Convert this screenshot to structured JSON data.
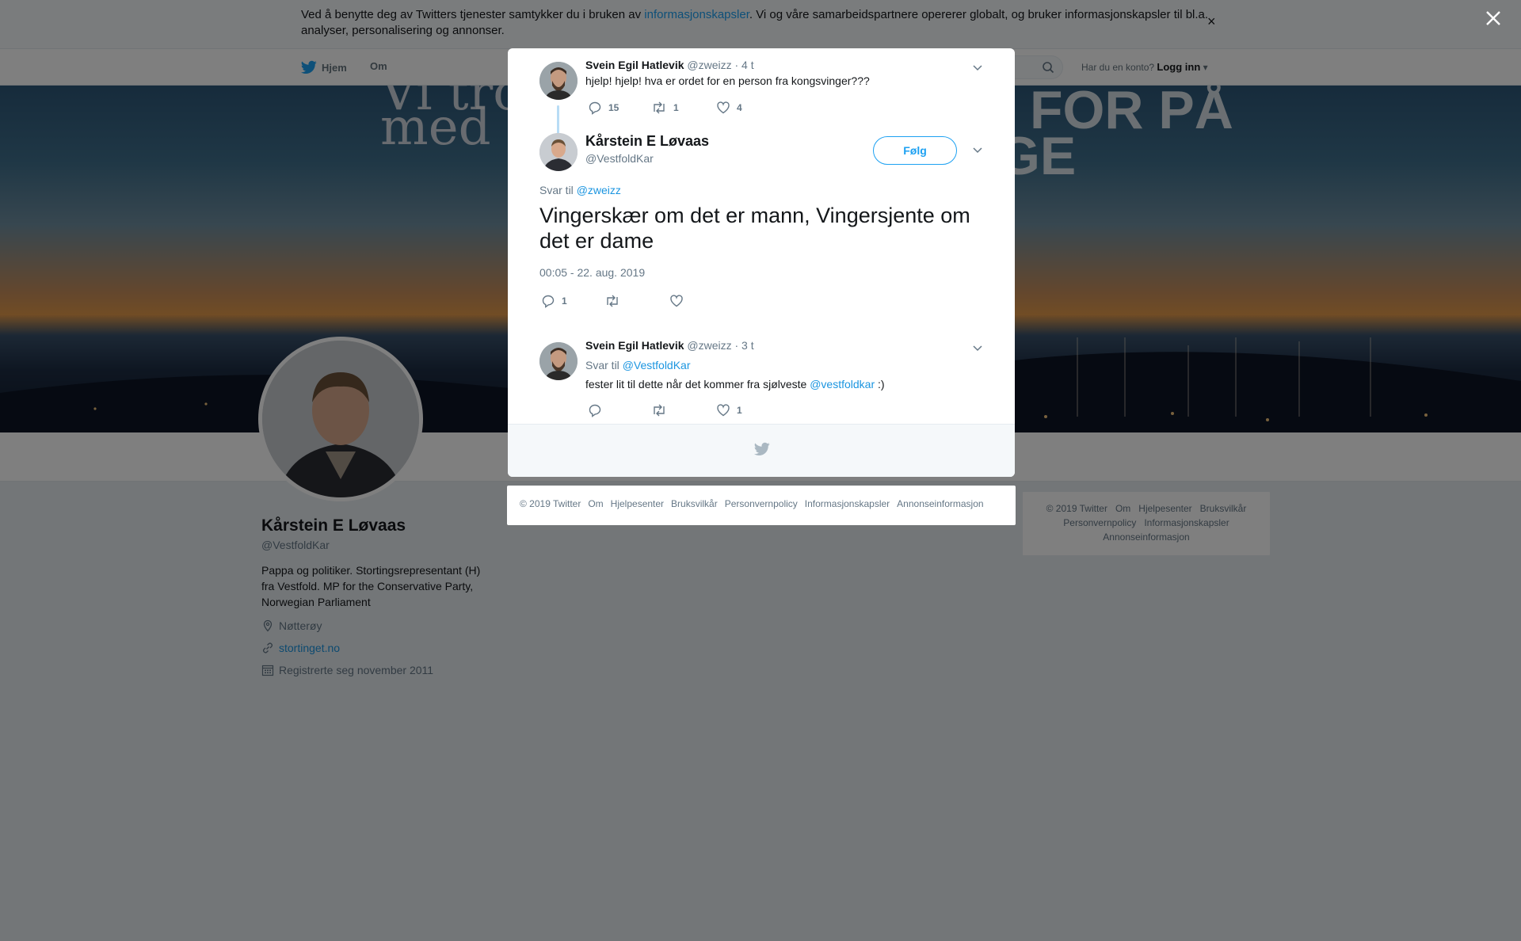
{
  "cookie_bar": {
    "text_before": "Ved å benytte deg av Twitters tjenester samtykker du i bruken av ",
    "link": "informasjonskapsler",
    "text_after": ". Vi og våre samarbeidspartnere opererer globalt, og bruker informasjonskapsler til bl.a. analyser, personalisering og annonser.",
    "close": "×"
  },
  "nav": {
    "home": "Hjem",
    "about": "Om",
    "account_prompt": "Har du en konto?",
    "login": "Logg inn"
  },
  "banner": {
    "line1": "Vi tror",
    "line2": "med",
    "right1": "FOR PÅ",
    "right2": "GE"
  },
  "profile": {
    "name": "Kårstein E Løvaas",
    "handle": "@VestfoldKar",
    "bio": "Pappa og politiker. Stortingsrepresentant (H) fra Vestfold. MP for the Conservative Party, Norwegian Parliament",
    "location": "Nøtterøy",
    "website": "stortinget.no",
    "joined": "Registrerte seg november 2011"
  },
  "side_footer": {
    "items": [
      "© 2019 Twitter",
      "Om",
      "Hjelpesenter",
      "Bruksvilkår",
      "Personvernpolicy",
      "Informasjonskapsler",
      "Annonseinformasjon"
    ]
  },
  "modal": {
    "parent_tweet": {
      "name": "Svein Egil Hatlevik",
      "handle": "@zweizz",
      "time": "· 4 t",
      "text": "hjelp! hjelp! hva er ordet for en person fra kongsvinger???",
      "replies": "15",
      "retweets": "1",
      "likes": "4"
    },
    "main_tweet": {
      "name": "Kårstein E Løvaas",
      "handle": "@VestfoldKar",
      "follow": "Følg",
      "reply_to_label": "Svar til",
      "reply_to_mention": "@zweizz",
      "text": "Vingerskær om det er mann, Vingersjente om det er dame",
      "timestamp": "00:05 - 22. aug. 2019",
      "replies": "1"
    },
    "reply_tweet": {
      "name": "Svein Egil Hatlevik",
      "handle": "@zweizz",
      "time": "· 3 t",
      "reply_to_label": "Svar til",
      "reply_to_mention": "@VestfoldKar",
      "text_before": "fester lit til dette når det kommer fra sjølveste ",
      "text_mention": "@vestfoldkar",
      "text_after": " :)",
      "likes": "1"
    }
  },
  "modal_footer": {
    "items": [
      "© 2019 Twitter",
      "Om",
      "Hjelpesenter",
      "Bruksvilkår",
      "Personvernpolicy",
      "Informasjonskapsler",
      "Annonseinformasjon"
    ]
  },
  "colors": {
    "accent": "#1da1f2",
    "link": "#1b95e0",
    "muted": "#657786",
    "overlay": "rgba(0,0,0,0.5)"
  }
}
